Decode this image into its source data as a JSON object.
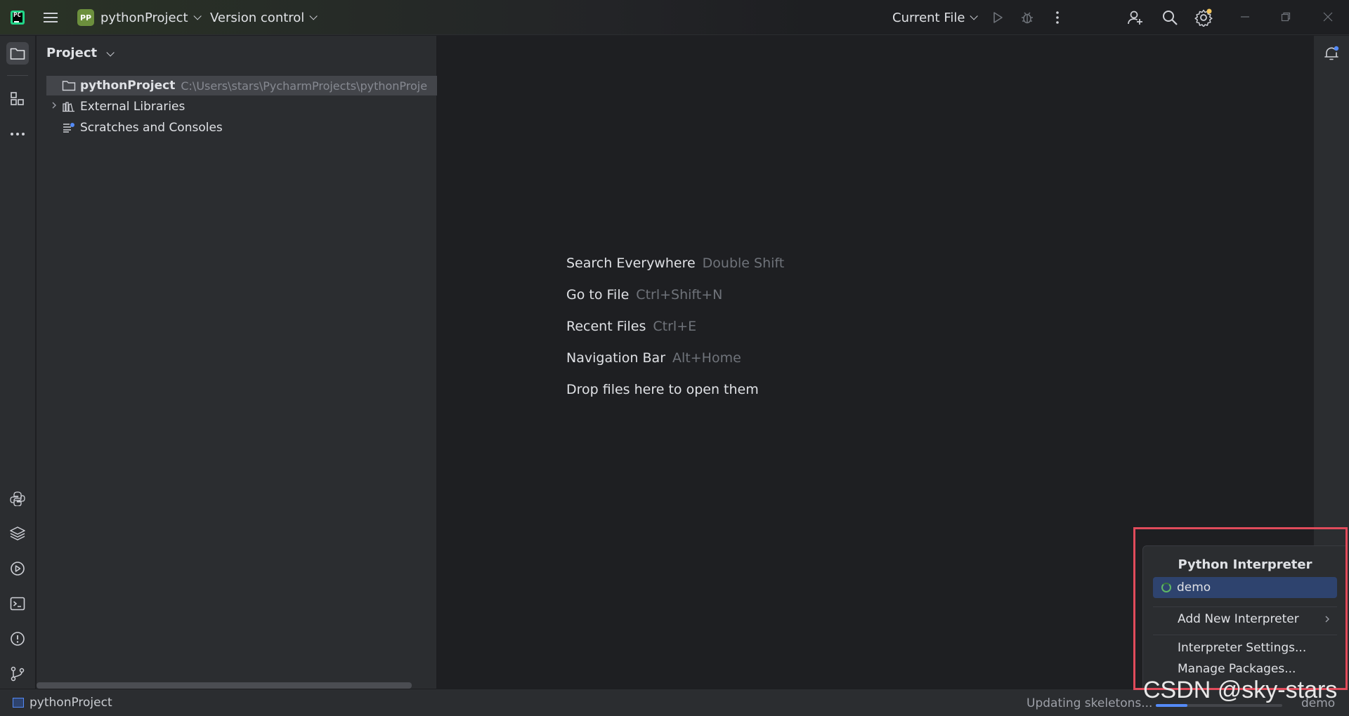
{
  "titlebar": {
    "app_logo_text": "PC",
    "project_badge": "PP",
    "project_name": "pythonProject",
    "version_control": "Version control",
    "run_config": "Current File"
  },
  "icons": {
    "menu": "hamburger-icon",
    "run": "play-icon",
    "debug": "bug-icon",
    "more": "more-vertical-icon",
    "add_user": "add-user-icon",
    "search": "search-icon",
    "settings": "gear-icon",
    "minimize": "minimize-icon",
    "restore": "restore-icon",
    "close": "close-icon",
    "notifications": "bell-icon"
  },
  "left_strip": [
    "folder-icon",
    "structure-icon",
    "more-horizontal-icon",
    "python-console-icon",
    "layers-icon",
    "services-icon",
    "terminal-icon",
    "problems-icon",
    "git-icon"
  ],
  "project_panel": {
    "title": "Project",
    "tree": [
      {
        "label": "pythonProject",
        "path": "C:\\Users\\stars\\PycharmProjects\\pythonProje"
      },
      {
        "label": "External Libraries"
      },
      {
        "label": "Scratches and Consoles"
      }
    ]
  },
  "editor": {
    "hints": [
      {
        "label": "Search Everywhere",
        "key": "Double Shift"
      },
      {
        "label": "Go to File",
        "key": "Ctrl+Shift+N"
      },
      {
        "label": "Recent Files",
        "key": "Ctrl+E"
      },
      {
        "label": "Navigation Bar",
        "key": "Alt+Home"
      },
      {
        "label": "Drop files here to open them",
        "key": ""
      }
    ]
  },
  "popup": {
    "title": "Python Interpreter",
    "selected": "demo",
    "add_new": "Add New Interpreter",
    "settings": "Interpreter Settings...",
    "manage": "Manage Packages..."
  },
  "statusbar": {
    "project": "pythonProject",
    "progress_text": "Updating skeletons...",
    "progress": 0.25,
    "interpreter": "demo"
  },
  "colors": {
    "accent": "#548af7",
    "highlight_frame": "#e04b5b",
    "selection": "#2e436e"
  },
  "watermark": "CSDN @sky-stars"
}
